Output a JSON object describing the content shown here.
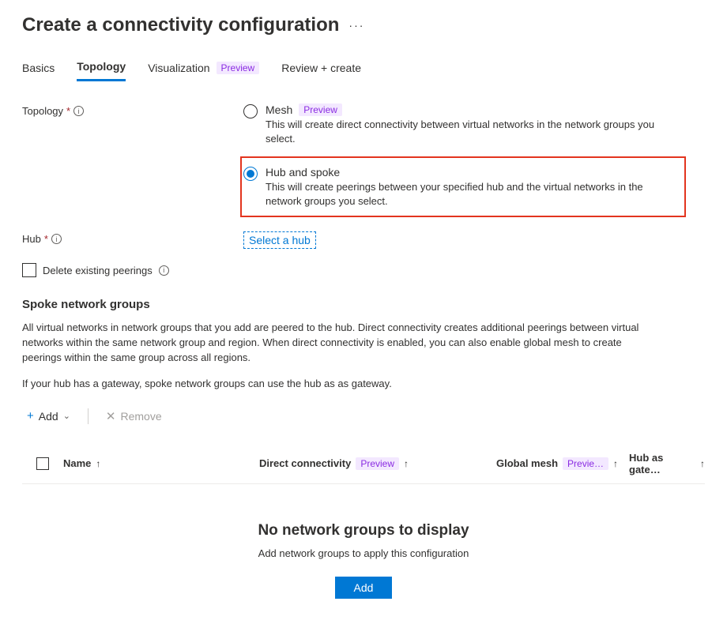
{
  "page": {
    "title": "Create a connectivity configuration",
    "more_glyph": "···"
  },
  "tabs": {
    "basics": "Basics",
    "topology": "Topology",
    "visualization": "Visualization",
    "visualization_badge": "Preview",
    "review": "Review + create"
  },
  "topology_field": {
    "label": "Topology",
    "required": "*",
    "options": {
      "mesh": {
        "label": "Mesh",
        "badge": "Preview",
        "desc": "This will create direct connectivity between virtual networks in the network groups you select."
      },
      "hub": {
        "label": "Hub and spoke",
        "desc": "This will create peerings between your specified hub and the virtual networks in the network groups you select."
      }
    }
  },
  "hub_field": {
    "label": "Hub",
    "required": "*",
    "select_link": "Select a hub"
  },
  "delete_peerings": {
    "label": "Delete existing peerings"
  },
  "spoke_section": {
    "heading": "Spoke network groups",
    "para1": "All virtual networks in network groups that you add are peered to the hub. Direct connectivity creates additional peerings between virtual networks within the same network group and region. When direct connectivity is enabled, you can also enable global mesh to create peerings within the same group across all regions.",
    "para2": "If your hub has a gateway, spoke network groups can use the hub as as gateway."
  },
  "cmdbar": {
    "add": "Add",
    "remove": "Remove"
  },
  "table": {
    "name": "Name",
    "direct_connectivity": "Direct connectivity",
    "direct_connectivity_badge": "Preview",
    "global_mesh": "Global mesh",
    "global_mesh_badge": "Previe…",
    "hub_as_gateway": "Hub as gate…"
  },
  "empty": {
    "title": "No network groups to display",
    "subtitle": "Add network groups to apply this configuration",
    "button": "Add"
  },
  "glyphs": {
    "info": "i",
    "plus": "+",
    "x": "✕",
    "chevron_down": "⌄",
    "up_arrow": "↑"
  }
}
